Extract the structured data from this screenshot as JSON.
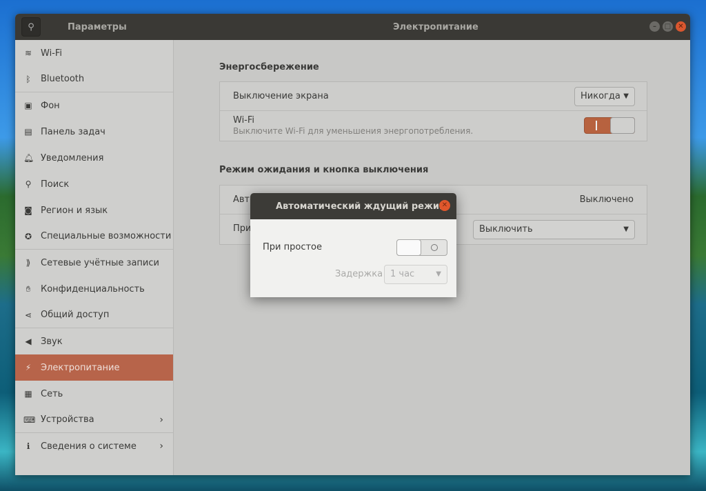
{
  "window": {
    "app_title": "Параметры",
    "page_title": "Электропитание"
  },
  "sidebar": {
    "items": [
      {
        "label": "Wi-Fi",
        "icon": "wifi-icon"
      },
      {
        "label": "Bluetooth",
        "icon": "bluetooth-icon"
      },
      {
        "label": "Фон",
        "icon": "background-icon"
      },
      {
        "label": "Панель задач",
        "icon": "dock-icon"
      },
      {
        "label": "Уведомления",
        "icon": "bell-icon"
      },
      {
        "label": "Поиск",
        "icon": "search-icon"
      },
      {
        "label": "Регион и язык",
        "icon": "camera-icon"
      },
      {
        "label": "Специальные возможности",
        "icon": "accessibility-icon"
      },
      {
        "label": "Сетевые учётные записи",
        "icon": "online-accounts-icon"
      },
      {
        "label": "Конфиденциальность",
        "icon": "hand-icon"
      },
      {
        "label": "Общий доступ",
        "icon": "share-icon"
      },
      {
        "label": "Звук",
        "icon": "speaker-icon"
      },
      {
        "label": "Электропитание",
        "icon": "power-icon",
        "active": true
      },
      {
        "label": "Сеть",
        "icon": "network-icon"
      },
      {
        "label": "Устройства",
        "icon": "devices-icon"
      },
      {
        "label": "Сведения о системе",
        "icon": "info-icon"
      }
    ]
  },
  "power_saving": {
    "heading": "Энергосбережение",
    "screen_off_label": "Выключение экрана",
    "screen_off_value": "Никогда",
    "wifi_label": "Wi-Fi",
    "wifi_desc": "Выключите Wi-Fi для уменьшения энергопотребления.",
    "wifi_on": true
  },
  "suspend": {
    "heading": "Режим ожидания и кнопка выключения",
    "auto_label": "Авто",
    "auto_value": "Выключено",
    "button_label": "При",
    "button_value": "Выключить"
  },
  "dialog": {
    "title": "Автоматический ждущий режим",
    "idle_label": "При простое",
    "idle_on": false,
    "delay_label": "Задержка",
    "delay_value": "1 час"
  },
  "colors": {
    "accent": "#e95420",
    "titlebar": "#3c3b37"
  }
}
